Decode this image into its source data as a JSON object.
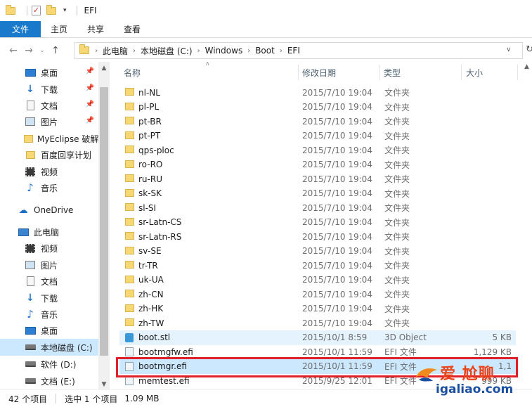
{
  "window": {
    "title": "EFI"
  },
  "ribbon": {
    "tabs": [
      {
        "label": "文件"
      },
      {
        "label": "主页"
      },
      {
        "label": "共享"
      },
      {
        "label": "查看"
      }
    ]
  },
  "address": {
    "crumbs": [
      "此电脑",
      "本地磁盘 (C:)",
      "Windows",
      "Boot",
      "EFI"
    ]
  },
  "nav": {
    "items": [
      {
        "label": "桌面",
        "icon": "desktop-icon",
        "pinned": true
      },
      {
        "label": "下载",
        "icon": "download-icon",
        "pinned": true
      },
      {
        "label": "文档",
        "icon": "document-icon",
        "pinned": true
      },
      {
        "label": "图片",
        "icon": "picture-icon",
        "pinned": true
      },
      {
        "label": "MyEclipse 破解",
        "icon": "folder-icon"
      },
      {
        "label": "百度回享计划",
        "icon": "folder-icon"
      },
      {
        "label": "视频",
        "icon": "video-icon"
      },
      {
        "label": "音乐",
        "icon": "music-icon"
      },
      {
        "label": "OneDrive",
        "icon": "onedrive-icon"
      },
      {
        "label": "此电脑",
        "icon": "this-pc-icon"
      },
      {
        "label": "视频",
        "icon": "video-icon"
      },
      {
        "label": "图片",
        "icon": "picture-icon"
      },
      {
        "label": "文档",
        "icon": "document-icon"
      },
      {
        "label": "下载",
        "icon": "download-icon"
      },
      {
        "label": "音乐",
        "icon": "music-icon"
      },
      {
        "label": "桌面",
        "icon": "desktop-icon"
      },
      {
        "label": "本地磁盘 (C:)",
        "icon": "drive-icon",
        "selected": true
      },
      {
        "label": "软件 (D:)",
        "icon": "drive-icon"
      },
      {
        "label": "文档 (E:)",
        "icon": "drive-icon"
      }
    ]
  },
  "columns": {
    "name": "名称",
    "date": "修改日期",
    "type": "类型",
    "size": "大小"
  },
  "files": [
    {
      "name": "nl-NL",
      "date": "2015/7/10 19:04",
      "type": "文件夹",
      "size": "",
      "icon": "folder-icon"
    },
    {
      "name": "pl-PL",
      "date": "2015/7/10 19:04",
      "type": "文件夹",
      "size": "",
      "icon": "folder-icon"
    },
    {
      "name": "pt-BR",
      "date": "2015/7/10 19:04",
      "type": "文件夹",
      "size": "",
      "icon": "folder-icon"
    },
    {
      "name": "pt-PT",
      "date": "2015/7/10 19:04",
      "type": "文件夹",
      "size": "",
      "icon": "folder-icon"
    },
    {
      "name": "qps-ploc",
      "date": "2015/7/10 19:04",
      "type": "文件夹",
      "size": "",
      "icon": "folder-icon"
    },
    {
      "name": "ro-RO",
      "date": "2015/7/10 19:04",
      "type": "文件夹",
      "size": "",
      "icon": "folder-icon"
    },
    {
      "name": "ru-RU",
      "date": "2015/7/10 19:04",
      "type": "文件夹",
      "size": "",
      "icon": "folder-icon"
    },
    {
      "name": "sk-SK",
      "date": "2015/7/10 19:04",
      "type": "文件夹",
      "size": "",
      "icon": "folder-icon"
    },
    {
      "name": "sl-SI",
      "date": "2015/7/10 19:04",
      "type": "文件夹",
      "size": "",
      "icon": "folder-icon"
    },
    {
      "name": "sr-Latn-CS",
      "date": "2015/7/10 19:04",
      "type": "文件夹",
      "size": "",
      "icon": "folder-icon"
    },
    {
      "name": "sr-Latn-RS",
      "date": "2015/7/10 19:04",
      "type": "文件夹",
      "size": "",
      "icon": "folder-icon"
    },
    {
      "name": "sv-SE",
      "date": "2015/7/10 19:04",
      "type": "文件夹",
      "size": "",
      "icon": "folder-icon"
    },
    {
      "name": "tr-TR",
      "date": "2015/7/10 19:04",
      "type": "文件夹",
      "size": "",
      "icon": "folder-icon"
    },
    {
      "name": "uk-UA",
      "date": "2015/7/10 19:04",
      "type": "文件夹",
      "size": "",
      "icon": "folder-icon"
    },
    {
      "name": "zh-CN",
      "date": "2015/7/10 19:04",
      "type": "文件夹",
      "size": "",
      "icon": "folder-icon"
    },
    {
      "name": "zh-HK",
      "date": "2015/7/10 19:04",
      "type": "文件夹",
      "size": "",
      "icon": "folder-icon"
    },
    {
      "name": "zh-TW",
      "date": "2015/7/10 19:04",
      "type": "文件夹",
      "size": "",
      "icon": "folder-icon"
    },
    {
      "name": "boot.stl",
      "date": "2015/10/1 8:59",
      "type": "3D Object",
      "size": "5 KB",
      "icon": "stl-file-icon",
      "highlight": true
    },
    {
      "name": "bootmgfw.efi",
      "date": "2015/10/1 11:59",
      "type": "EFI 文件",
      "size": "1,129 KB",
      "icon": "efi-file-icon"
    },
    {
      "name": "bootmgr.efi",
      "date": "2015/10/1 11:59",
      "type": "EFI 文件",
      "size": "1,1",
      "icon": "efi-file-icon",
      "selected": true
    },
    {
      "name": "memtest.efi",
      "date": "2015/9/25 12:01",
      "type": "EFI 文件",
      "size": "999 KB",
      "icon": "efi-file-icon"
    }
  ],
  "status": {
    "count": "42 个项目",
    "selected": "选中 1 个项目",
    "size": "1.09 MB"
  },
  "watermark": {
    "brand": "爱  尬聊",
    "url": "igaliao.com"
  },
  "colors": {
    "accent": "#1979ca",
    "selected_bg": "#cce8ff",
    "hover_bg": "#e5f3ff",
    "red_box": "#e0202a"
  }
}
